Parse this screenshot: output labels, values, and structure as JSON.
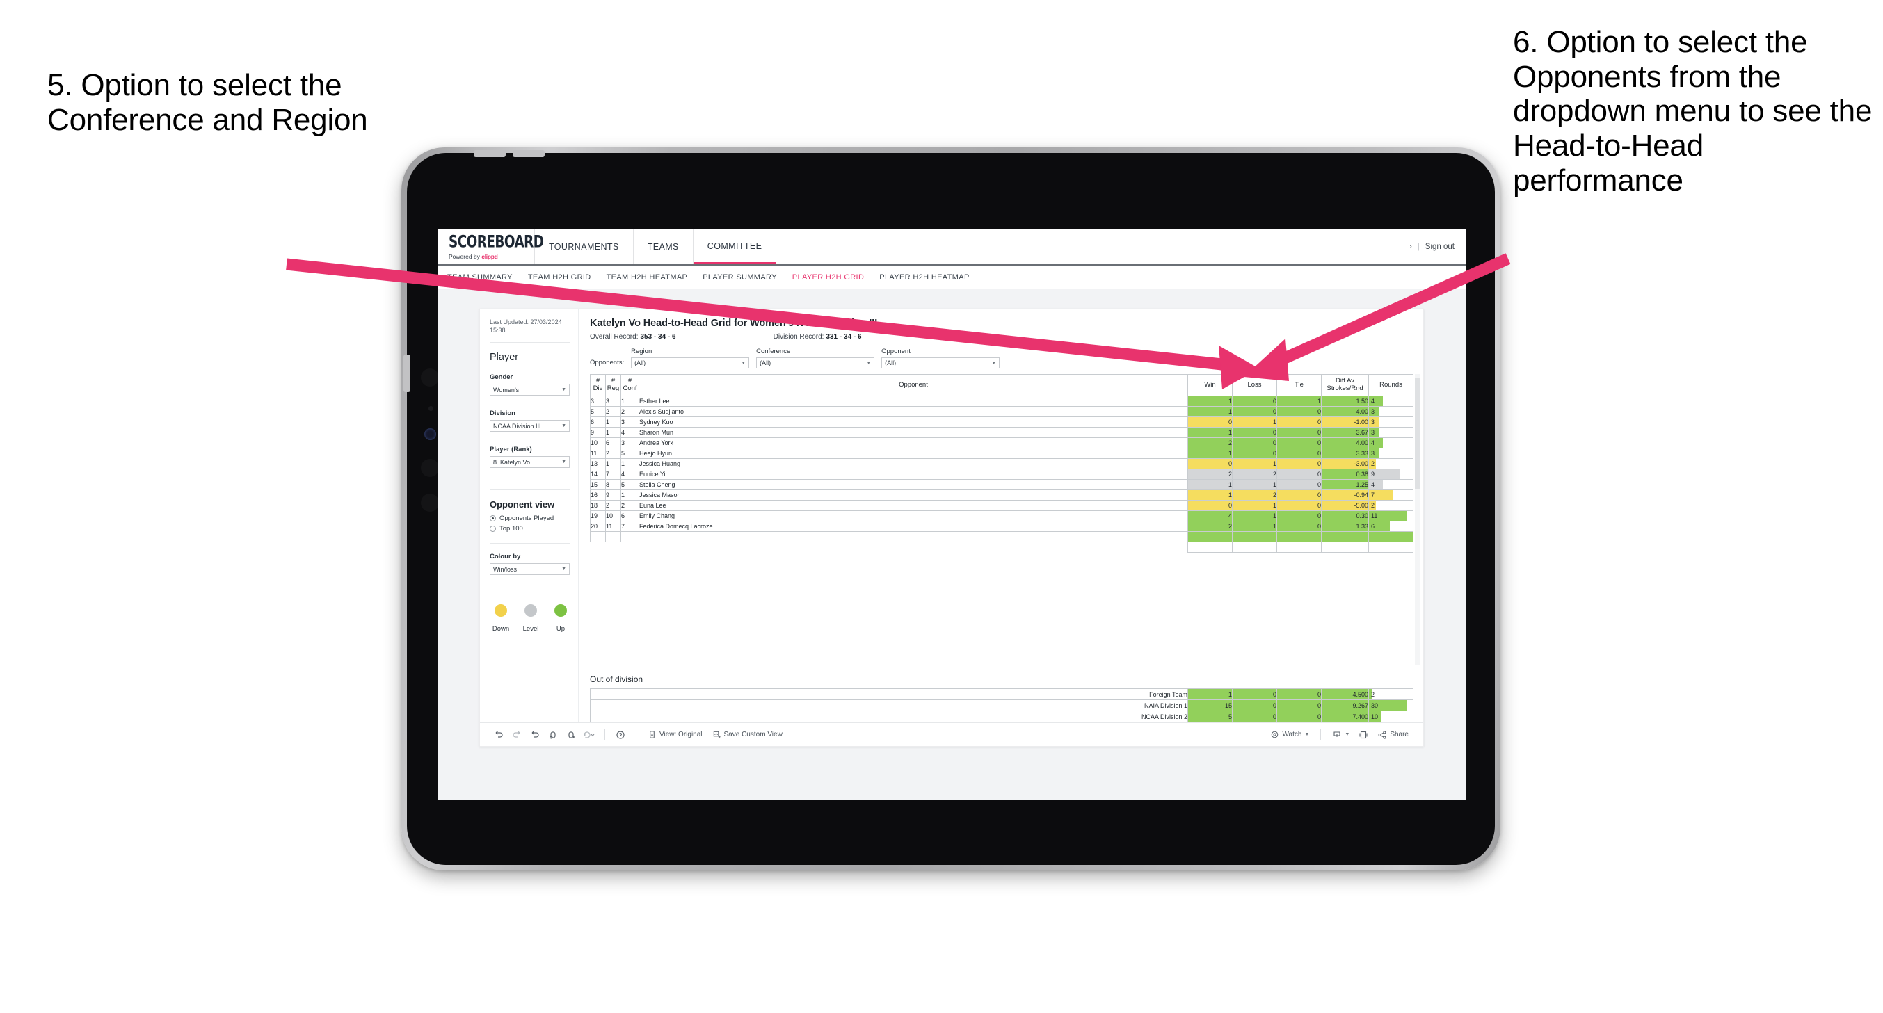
{
  "annotations": {
    "left": "5. Option to select the Conference and Region",
    "right": "6. Option to select the Opponents from the dropdown menu to see the Head-to-Head performance",
    "arrow_color": "#e8336d"
  },
  "topnav": {
    "logo": "SCOREBOARD",
    "logo_powered": "Powered by",
    "logo_brand": "clippd",
    "items": [
      {
        "label": "TOURNAMENTS",
        "active": false
      },
      {
        "label": "TEAMS",
        "active": false
      },
      {
        "label": "COMMITTEE",
        "active": true
      }
    ],
    "chevron": "›",
    "separator": "|",
    "signout": "Sign out"
  },
  "subnav": {
    "items": [
      {
        "label": "TEAM SUMMARY",
        "active": false
      },
      {
        "label": "TEAM H2H GRID",
        "active": false
      },
      {
        "label": "TEAM H2H HEATMAP",
        "active": false
      },
      {
        "label": "PLAYER SUMMARY",
        "active": false
      },
      {
        "label": "PLAYER H2H GRID",
        "active": true
      },
      {
        "label": "PLAYER H2H HEATMAP",
        "active": false
      }
    ],
    "active_color": "#e8336d"
  },
  "sidebar": {
    "last_updated": "Last Updated: 27/03/2024 15:38",
    "player_heading": "Player",
    "filters": [
      {
        "label": "Gender",
        "value": "Women’s"
      },
      {
        "label": "Division",
        "value": "NCAA Division III"
      },
      {
        "label": "Player (Rank)",
        "value": "8. Katelyn Vo"
      }
    ],
    "opponent_view": {
      "heading": "Opponent view",
      "options": [
        {
          "label": "Opponents Played",
          "selected": true
        },
        {
          "label": "Top 100",
          "selected": false
        }
      ]
    },
    "colour_by": {
      "label": "Colour by",
      "value": "Win/loss"
    },
    "legend": [
      {
        "label": "Down",
        "color": "#f2d14b"
      },
      {
        "label": "Level",
        "color": "#c4c7ca"
      },
      {
        "label": "Up",
        "color": "#7dc242"
      }
    ]
  },
  "main": {
    "title": "Katelyn Vo Head-to-Head Grid for Women’s NCAA Division III",
    "overall_record_label": "Overall Record:",
    "overall_record": "353 - 34 - 6",
    "division_record_label": "Division Record:",
    "division_record": "331 - 34 - 6",
    "filters_prefix": "Opponents:",
    "filters": [
      {
        "label": "Region",
        "value": "(All)"
      },
      {
        "label": "Conference",
        "value": "(All)"
      },
      {
        "label": "Opponent",
        "value": "(All)"
      }
    ]
  },
  "chart_data": {
    "type": "table",
    "title": "Katelyn Vo Head-to-Head Grid for Women’s NCAA Division III",
    "columns": [
      "# Div",
      "# Reg",
      "# Conf",
      "Opponent",
      "Win",
      "Loss",
      "Tie",
      "Diff Av Strokes/Rnd",
      "Rounds"
    ],
    "column_headers_multiline": [
      [
        "#",
        "Div"
      ],
      [
        "#",
        "Reg"
      ],
      [
        "#",
        "Conf"
      ],
      [
        "Opponent"
      ],
      [
        "Win"
      ],
      [
        "Loss"
      ],
      [
        "Tie"
      ],
      [
        "Diff Av",
        "Strokes/Rnd"
      ],
      [
        "Rounds"
      ]
    ],
    "colour_scale": {
      "up": "#92d05b",
      "level": "#d4d6d8",
      "down": "#f5dd5f"
    },
    "rounds_max": 11,
    "rows": [
      {
        "div": "3",
        "reg": "3",
        "conf": "1",
        "opponent": "Esther Lee",
        "win": "1",
        "loss": "0",
        "tie": "1",
        "diff": "1.50",
        "rounds": "4",
        "state": "up"
      },
      {
        "div": "5",
        "reg": "2",
        "conf": "2",
        "opponent": "Alexis Sudjianto",
        "win": "1",
        "loss": "0",
        "tie": "0",
        "diff": "4.00",
        "rounds": "3",
        "state": "up"
      },
      {
        "div": "6",
        "reg": "1",
        "conf": "3",
        "opponent": "Sydney Kuo",
        "win": "0",
        "loss": "1",
        "tie": "0",
        "diff": "-1.00",
        "rounds": "3",
        "state": "down"
      },
      {
        "div": "9",
        "reg": "1",
        "conf": "4",
        "opponent": "Sharon Mun",
        "win": "1",
        "loss": "0",
        "tie": "0",
        "diff": "3.67",
        "rounds": "3",
        "state": "up"
      },
      {
        "div": "10",
        "reg": "6",
        "conf": "3",
        "opponent": "Andrea York",
        "win": "2",
        "loss": "0",
        "tie": "0",
        "diff": "4.00",
        "rounds": "4",
        "state": "up"
      },
      {
        "div": "11",
        "reg": "2",
        "conf": "5",
        "opponent": "Heejo Hyun",
        "win": "1",
        "loss": "0",
        "tie": "0",
        "diff": "3.33",
        "rounds": "3",
        "state": "up"
      },
      {
        "div": "13",
        "reg": "1",
        "conf": "1",
        "opponent": "Jessica Huang",
        "win": "0",
        "loss": "1",
        "tie": "0",
        "diff": "-3.00",
        "rounds": "2",
        "state": "down"
      },
      {
        "div": "14",
        "reg": "7",
        "conf": "4",
        "opponent": "Eunice Yi",
        "win": "2",
        "loss": "2",
        "tie": "0",
        "diff": "0.38",
        "rounds": "9",
        "state": "level",
        "diff_state": "up"
      },
      {
        "div": "15",
        "reg": "8",
        "conf": "5",
        "opponent": "Stella Cheng",
        "win": "1",
        "loss": "1",
        "tie": "0",
        "diff": "1.25",
        "rounds": "4",
        "state": "level",
        "diff_state": "up"
      },
      {
        "div": "16",
        "reg": "9",
        "conf": "1",
        "opponent": "Jessica Mason",
        "win": "1",
        "loss": "2",
        "tie": "0",
        "diff": "-0.94",
        "rounds": "7",
        "state": "down"
      },
      {
        "div": "18",
        "reg": "2",
        "conf": "2",
        "opponent": "Euna Lee",
        "win": "0",
        "loss": "1",
        "tie": "0",
        "diff": "-5.00",
        "rounds": "2",
        "state": "down"
      },
      {
        "div": "19",
        "reg": "10",
        "conf": "6",
        "opponent": "Emily Chang",
        "win": "4",
        "loss": "1",
        "tie": "0",
        "diff": "0.30",
        "rounds": "11",
        "state": "up"
      },
      {
        "div": "20",
        "reg": "11",
        "conf": "7",
        "opponent": "Federica Domecq Lacroze",
        "win": "2",
        "loss": "1",
        "tie": "0",
        "diff": "1.33",
        "rounds": "6",
        "state": "up"
      }
    ],
    "out_of_division": {
      "title": "Out of division",
      "rounds_max": 30,
      "rows": [
        {
          "name": "Foreign Team",
          "win": "1",
          "loss": "0",
          "tie": "0",
          "diff": "4.500",
          "rounds": "2",
          "state": "up"
        },
        {
          "name": "NAIA Division 1",
          "win": "15",
          "loss": "0",
          "tie": "0",
          "diff": "9.267",
          "rounds": "30",
          "state": "up"
        },
        {
          "name": "NCAA Division 2",
          "win": "5",
          "loss": "0",
          "tie": "0",
          "diff": "7.400",
          "rounds": "10",
          "state": "up"
        }
      ]
    }
  },
  "toolbar": {
    "icons": [
      "undo-icon",
      "redo-icon",
      "revert-icon",
      "refresh-icon",
      "pause-icon",
      "reset-icon",
      "help-icon"
    ],
    "view_label": "View: Original",
    "save_custom_view_label": "Save Custom View",
    "watch_label": "Watch",
    "share_label": "Share"
  }
}
